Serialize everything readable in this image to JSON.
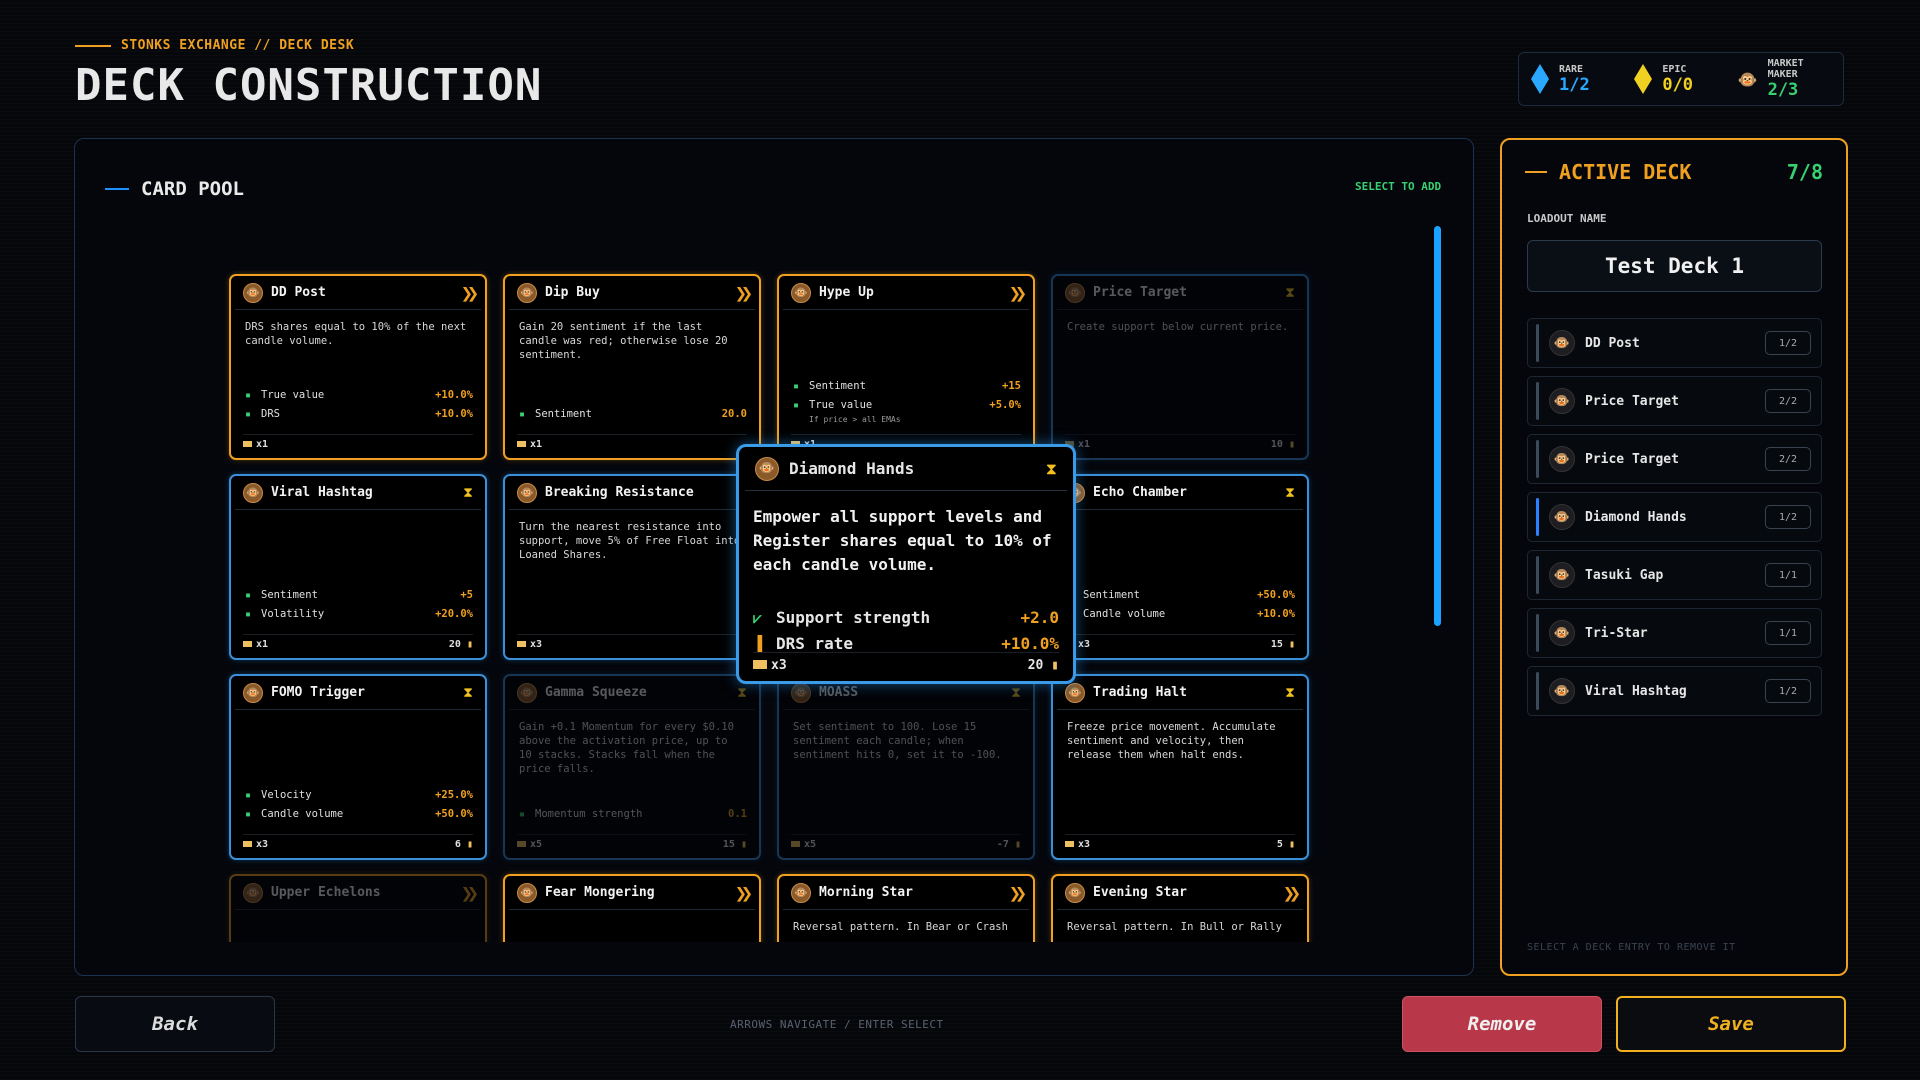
{
  "header": {
    "breadcrumb": "STONKS EXCHANGE // DECK DESK",
    "title": "DECK CONSTRUCTION"
  },
  "currencies": [
    {
      "label": "RARE",
      "value": "1/2",
      "icon": "blue-diamond-icon",
      "color": "#2aa8ff"
    },
    {
      "label": "EPIC",
      "value": "0/0",
      "icon": "yellow-diamond-icon",
      "color": "#f0d020"
    },
    {
      "label": "MARKET MAKER",
      "value": "2/3",
      "icon": "monkey-icon",
      "color": "#38d070"
    }
  ],
  "pool": {
    "title": "CARD POOL",
    "hint": "SELECT TO ADD"
  },
  "cards": [
    {
      "name": "DD Post",
      "border": "gold",
      "desc": "DRS shares equal to 10% of the next candle volume.",
      "stats": [
        {
          "k": "True value",
          "v": "+10.0%"
        },
        {
          "k": "DRS",
          "v": "+10.0%"
        }
      ],
      "count": "x1",
      "cost": ""
    },
    {
      "name": "Dip Buy",
      "border": "gold",
      "desc": "Gain 20 sentiment if the last candle was red; otherwise lose 20 sentiment.",
      "stats": [
        {
          "k": "Sentiment",
          "v": "20.0"
        }
      ],
      "count": "x1",
      "cost": ""
    },
    {
      "name": "Hype Up",
      "border": "gold",
      "desc": "",
      "stats": [
        {
          "k": "Sentiment",
          "v": "+15"
        },
        {
          "k": "True value",
          "v": "+5.0%",
          "sub": "If price > all EMAs"
        }
      ],
      "count": "x1",
      "cost": ""
    },
    {
      "name": "Price Target",
      "border": "blue",
      "desc": "Create support below current price.",
      "stats": [],
      "count": "x1",
      "cost": "10",
      "dim": true
    },
    {
      "name": "Viral Hashtag",
      "border": "blue",
      "desc": "",
      "stats": [
        {
          "k": "Sentiment",
          "v": "+5"
        },
        {
          "k": "Volatility",
          "v": "+20.0%"
        }
      ],
      "count": "x1",
      "cost": "20"
    },
    {
      "name": "Breaking Resistance",
      "border": "blue",
      "desc": "Turn the nearest resistance into support, move 5% of Free Float into Loaned Shares.",
      "stats": [],
      "count": "x3",
      "cost": ""
    },
    {
      "name": "Diamond Hands",
      "border": "blue",
      "desc": "",
      "stats": [],
      "count": "",
      "cost": ""
    },
    {
      "name": "Echo Chamber",
      "border": "blue",
      "desc": "",
      "stats": [
        {
          "k": "Sentiment",
          "v": "+50.0%"
        },
        {
          "k": "Candle volume",
          "v": "+10.0%"
        }
      ],
      "count": "x3",
      "cost": "15"
    },
    {
      "name": "FOMO Trigger",
      "border": "blue",
      "desc": "",
      "stats": [
        {
          "k": "Velocity",
          "v": "+25.0%"
        },
        {
          "k": "Candle volume",
          "v": "+50.0%"
        }
      ],
      "count": "x3",
      "cost": "6"
    },
    {
      "name": "Gamma Squeeze",
      "border": "blue",
      "desc": "Gain +0.1 Momentum for every $0.10 above the activation price, up to 10 stacks. Stacks fall when the price falls.",
      "stats": [
        {
          "k": "Momentum strength",
          "v": "0.1"
        }
      ],
      "count": "x5",
      "cost": "15",
      "dim": true
    },
    {
      "name": "MOASS",
      "border": "blue",
      "desc": "Set sentiment to 100. Lose 15 sentiment each candle; when sentiment hits 0, set it to -100.",
      "stats": [],
      "count": "x5",
      "cost": "-7",
      "dim": true
    },
    {
      "name": "Trading Halt",
      "border": "blue",
      "desc": "Freeze price movement. Accumulate sentiment and velocity, then release them when halt ends.",
      "stats": [],
      "count": "x3",
      "cost": "5"
    },
    {
      "name": "Upper Echelons",
      "border": "gold",
      "desc": "",
      "stats": [],
      "count": "",
      "cost": "",
      "dim": true
    },
    {
      "name": "Fear Mongering",
      "border": "gold",
      "desc": "",
      "stats": [],
      "count": "",
      "cost": ""
    },
    {
      "name": "Morning Star",
      "border": "gold",
      "desc": "Reversal pattern. In Bear or Crash",
      "stats": [],
      "count": "",
      "cost": ""
    },
    {
      "name": "Evening Star",
      "border": "gold",
      "desc": "Reversal pattern. In Bull or Rally",
      "stats": [],
      "count": "",
      "cost": ""
    }
  ],
  "popup": {
    "name": "Diamond Hands",
    "desc": "Empower all support levels and Register shares equal to 10% of each candle volume.",
    "stats": [
      {
        "k": "Support strength",
        "v": "+2.0"
      },
      {
        "k": "DRS rate",
        "v": "+10.0%"
      }
    ],
    "count": "x3",
    "cost": "20"
  },
  "deck": {
    "title": "ACTIVE DECK",
    "count": "7/8",
    "loadout_label": "LOADOUT NAME",
    "loadout_name": "Test Deck 1",
    "entries": [
      {
        "name": "DD Post",
        "count": "1/2"
      },
      {
        "name": "Price Target",
        "count": "2/2"
      },
      {
        "name": "Price Target",
        "count": "2/2"
      },
      {
        "name": "Diamond Hands",
        "count": "1/2",
        "selected": true
      },
      {
        "name": "Tasuki Gap",
        "count": "1/1"
      },
      {
        "name": "Tri-Star",
        "count": "1/1"
      },
      {
        "name": "Viral Hashtag",
        "count": "1/2"
      }
    ],
    "hint": "SELECT A DECK ENTRY TO REMOVE IT"
  },
  "footer": {
    "back": "Back",
    "nav_hint": "ARROWS NAVIGATE / ENTER SELECT",
    "remove": "Remove",
    "save": "Save"
  }
}
